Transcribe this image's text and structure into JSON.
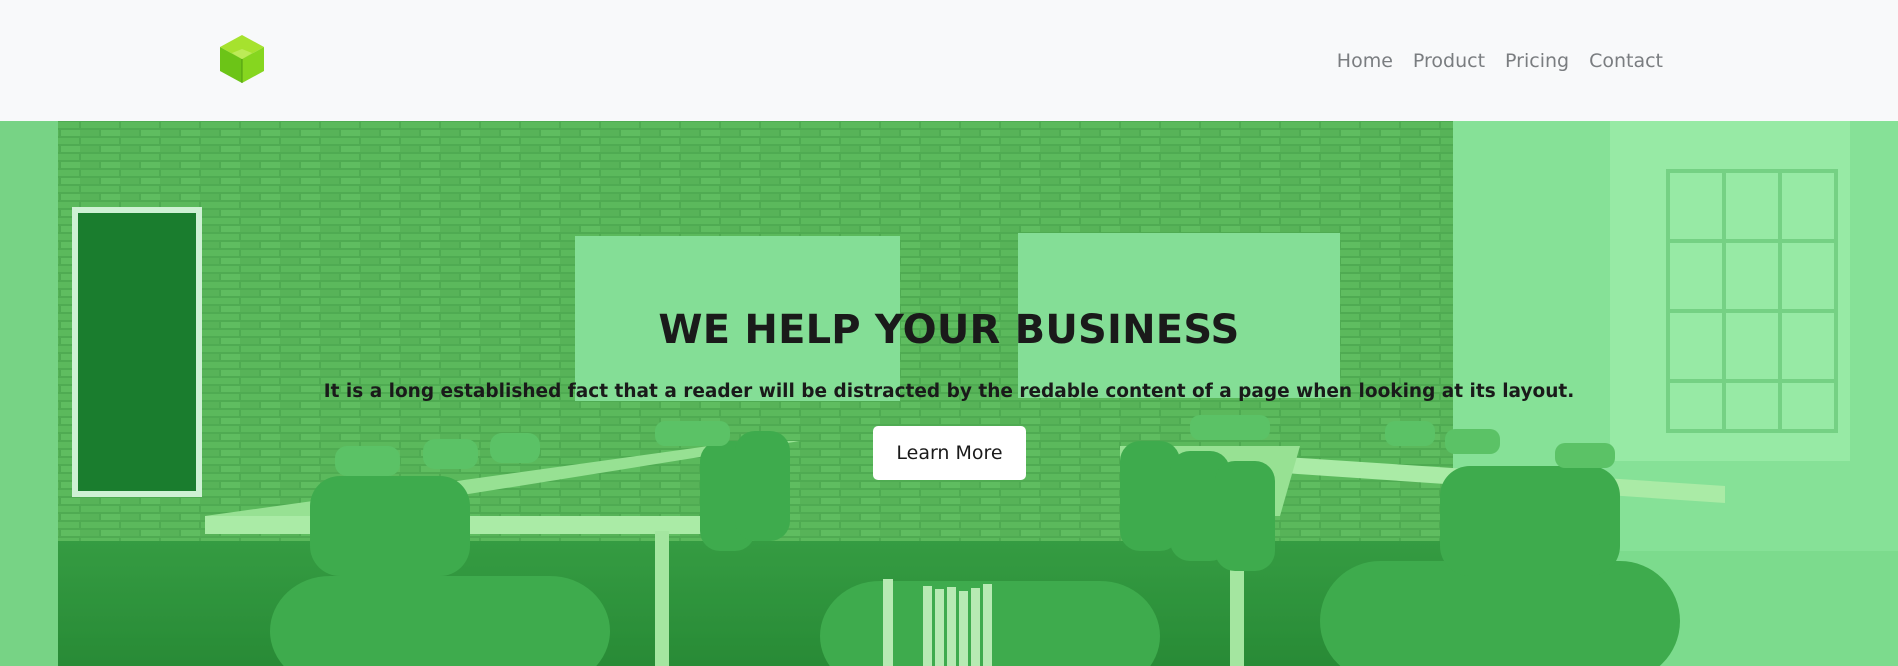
{
  "navbar": {
    "logo_icon": "green-cube-icon",
    "links": [
      {
        "label": "Home"
      },
      {
        "label": "Product"
      },
      {
        "label": "Pricing"
      },
      {
        "label": "Contact"
      }
    ]
  },
  "hero": {
    "background": "office-with-brick-wall-photo",
    "overlay_color": "#55d66b",
    "title": "WE HELP YOUR BUSINESS",
    "subtitle": "It is a long established fact that a reader will be distracted by the redable content of a page when looking at its layout.",
    "button_label": "Learn More"
  }
}
